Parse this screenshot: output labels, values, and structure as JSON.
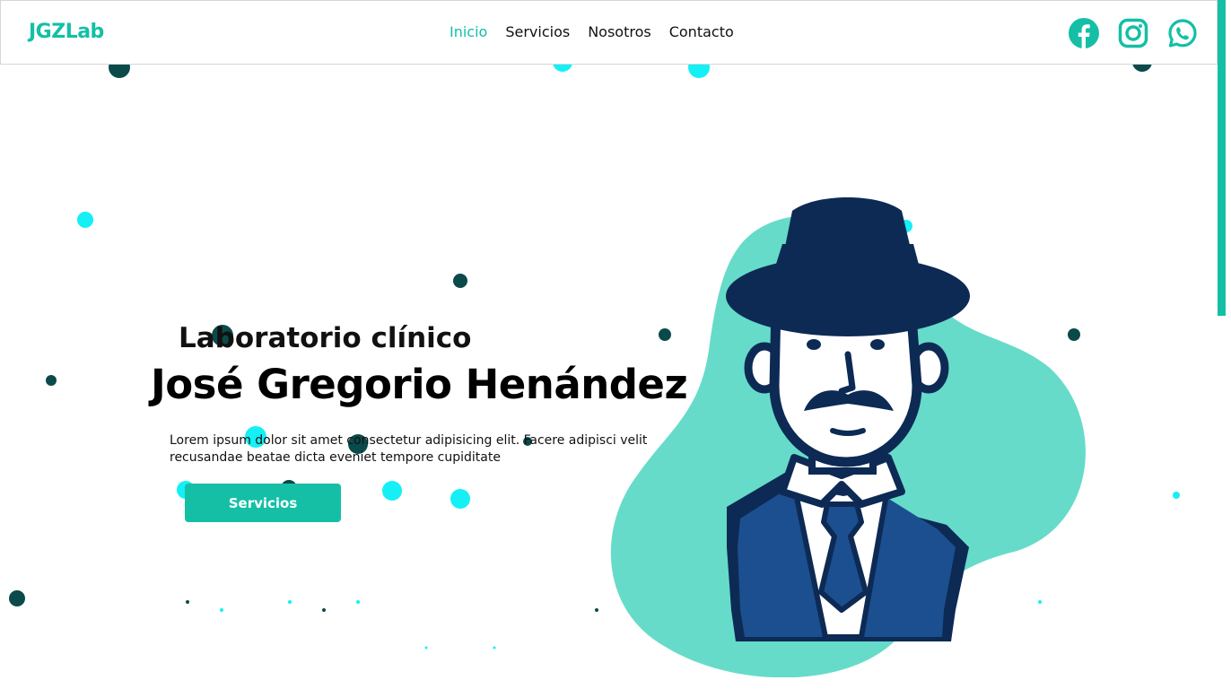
{
  "header": {
    "logo": "JGZLab",
    "nav": [
      {
        "label": "Inicio",
        "active": true
      },
      {
        "label": "Servicios",
        "active": false
      },
      {
        "label": "Nosotros",
        "active": false
      },
      {
        "label": "Contacto",
        "active": false
      }
    ],
    "socials": [
      "facebook-icon",
      "instagram-icon",
      "whatsapp-icon"
    ]
  },
  "hero": {
    "subtitle": "Laboratorio clínico",
    "title": "José Gregorio Henández",
    "description": "Lorem ipsum dolor sit amet consectetur adipisicing elit. Facere adipisci velit recusandae beatae dicta eveniet tempore cupiditate",
    "cta_label": "Servicios",
    "illustration": "doctor-portrait-illustration"
  },
  "colors": {
    "accent": "#14bfa6",
    "blob": "#66dbc9",
    "particle_dark": "#0b4a4a",
    "particle_cyan": "#14f0f5",
    "navy": "#0d2a55",
    "suit_blue": "#1c4f8f"
  }
}
